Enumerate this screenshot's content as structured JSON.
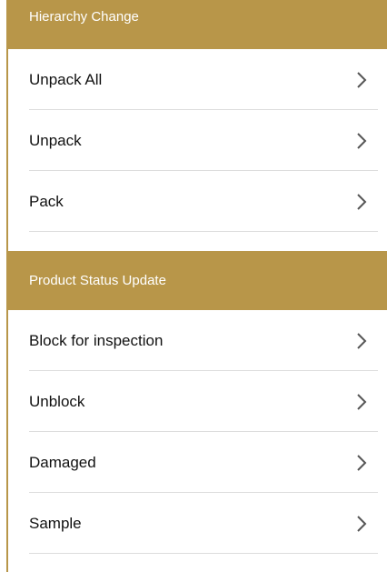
{
  "sections": [
    {
      "title": "Hierarchy Change",
      "items": [
        {
          "label": "Unpack All",
          "icon": "chevron-right-icon"
        },
        {
          "label": "Unpack",
          "icon": "chevron-right-icon"
        },
        {
          "label": "Pack",
          "icon": "chevron-right-icon"
        }
      ]
    },
    {
      "title": "Product Status Update",
      "items": [
        {
          "label": "Block for inspection",
          "icon": "chevron-right-icon"
        },
        {
          "label": "Unblock",
          "icon": "chevron-right-icon"
        },
        {
          "label": "Damaged",
          "icon": "chevron-right-icon"
        },
        {
          "label": "Sample",
          "icon": "chevron-right-icon"
        }
      ]
    }
  ],
  "colors": {
    "header_background": "#b89649",
    "header_text": "#ffffff",
    "item_text": "#111111",
    "divider": "#dddddd",
    "chevron": "#555555"
  }
}
